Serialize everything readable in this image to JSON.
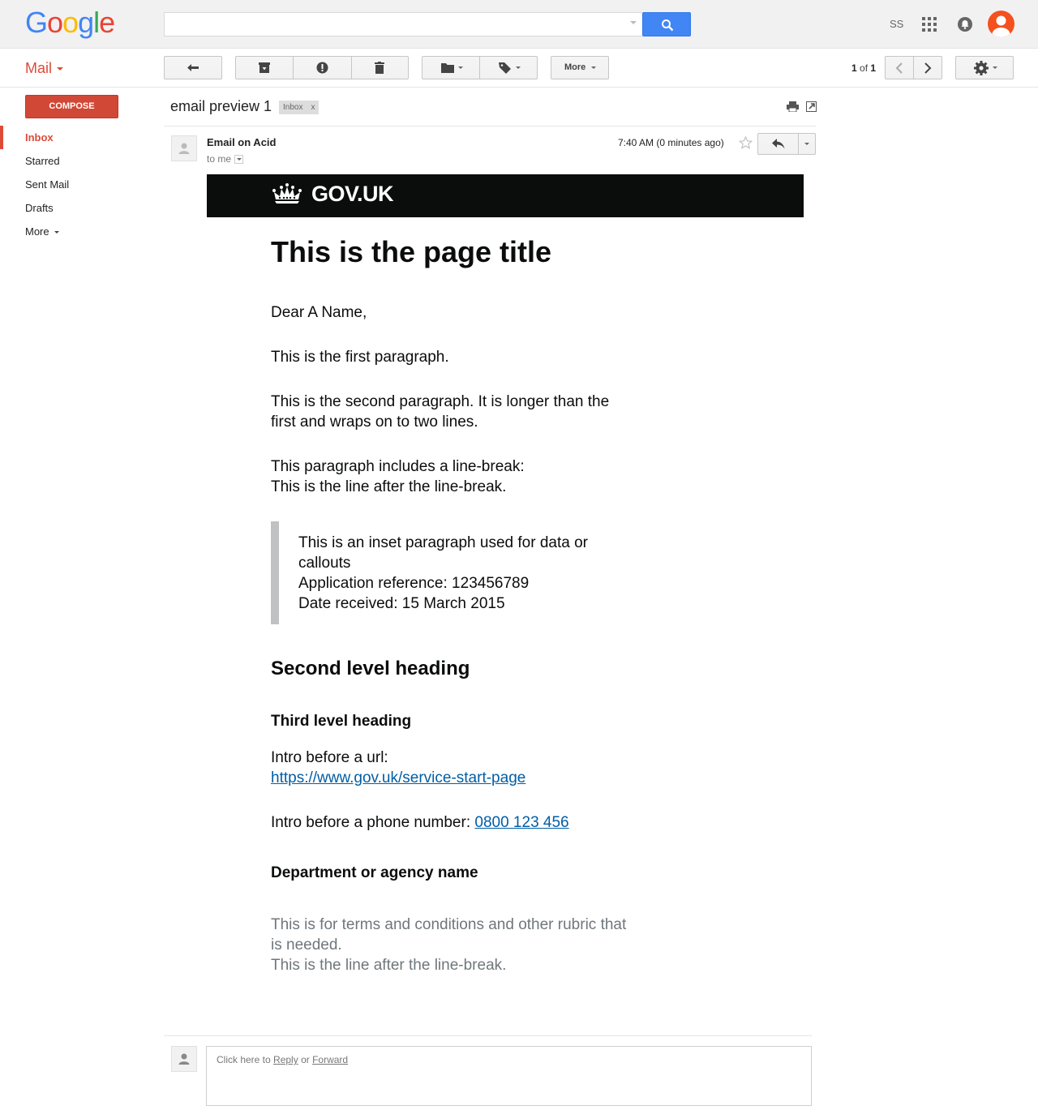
{
  "google": {
    "logo_letters": [
      {
        "ch": "G",
        "color": "#4285f4"
      },
      {
        "ch": "o",
        "color": "#ea4335"
      },
      {
        "ch": "o",
        "color": "#fbbc05"
      },
      {
        "ch": "g",
        "color": "#4285f4"
      },
      {
        "ch": "l",
        "color": "#34a853"
      },
      {
        "ch": "e",
        "color": "#ea4335"
      }
    ],
    "search_value": "",
    "user_initials": "SS"
  },
  "toolbar": {
    "mail_label": "Mail",
    "more_label": "More",
    "pager_current": "1",
    "pager_of": "of",
    "pager_total": "1"
  },
  "sidebar": {
    "compose_label": "COMPOSE",
    "items": [
      {
        "label": "Inbox",
        "active": true
      },
      {
        "label": "Starred"
      },
      {
        "label": "Sent Mail"
      },
      {
        "label": "Drafts"
      },
      {
        "label": "More"
      }
    ]
  },
  "thread": {
    "subject": "email preview 1",
    "label_chip": "Inbox",
    "chip_close": "x",
    "sender": "Email on Acid",
    "to": "to me",
    "time": "7:40 AM (0 minutes ago)"
  },
  "email": {
    "brand": "GOV.UK",
    "title": "This is the page title",
    "greeting": "Dear A Name,",
    "para1": "This is the first paragraph.",
    "para2": "This is the second paragraph. It is longer than the first and wraps on to two lines.",
    "para3_line1": "This paragraph includes a line-break:",
    "para3_line2": "This is the line after the line-break.",
    "inset_line1": "This is an inset paragraph used for data or callouts",
    "inset_line2": "Application reference: 123456789",
    "inset_line3": "Date received: 15 March 2015",
    "h2": "Second level heading",
    "h3": "Third level heading",
    "url_intro": "Intro before a url:",
    "url": "https://www.gov.uk/service-start-page",
    "phone_intro": "Intro before a phone number:",
    "phone": "0800 123 456",
    "dept": "Department or agency name",
    "terms_line1": "This is for terms and conditions and other rubric that is needed.",
    "terms_line2": "This is the line after the line-break."
  },
  "reply": {
    "prefix": "Click here to",
    "reply_link": "Reply",
    "or": "or",
    "forward_link": "Forward"
  },
  "colors": {
    "accent_red": "#dd4b39",
    "search_blue": "#4285f4",
    "govuk_black": "#0b0c0c",
    "link_blue": "#005ea5"
  }
}
